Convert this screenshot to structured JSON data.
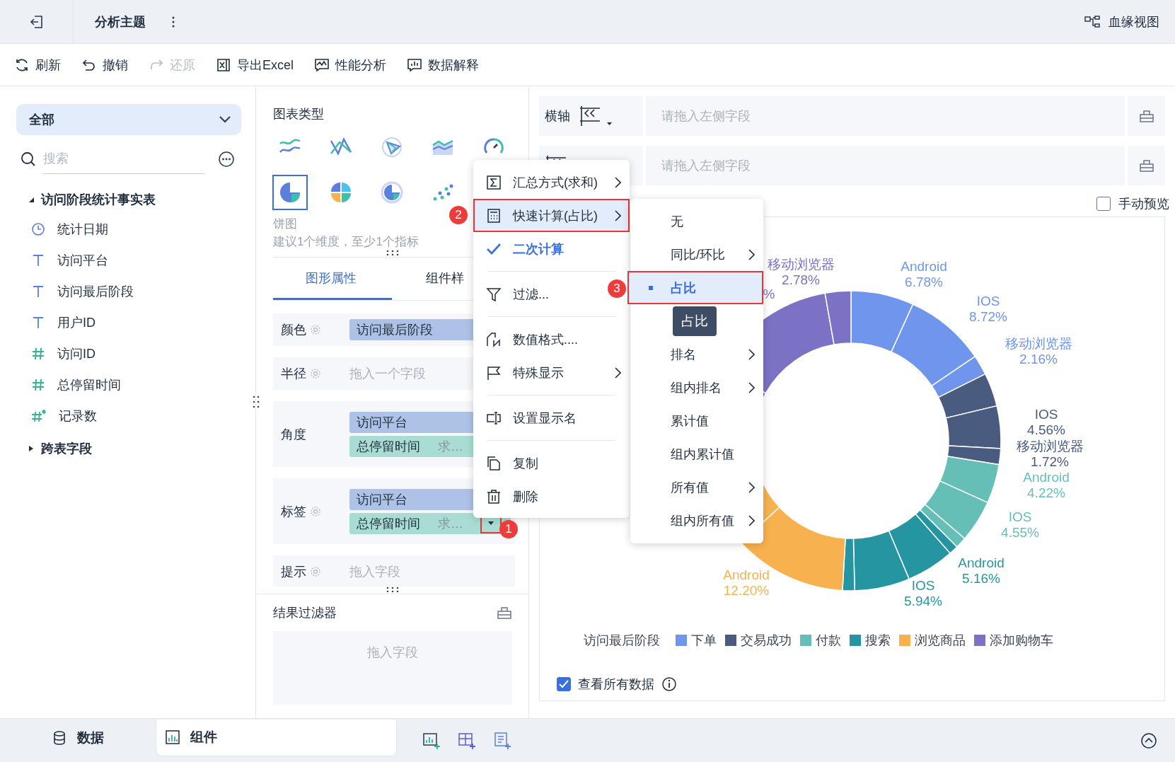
{
  "topbar": {
    "title": "分析主题",
    "lineage": "血缘视图"
  },
  "toolbar": [
    {
      "label": "刷新",
      "disabled": false
    },
    {
      "label": "撤销",
      "disabled": false
    },
    {
      "label": "还原",
      "disabled": true
    },
    {
      "label": "导出Excel",
      "disabled": false
    },
    {
      "label": "性能分析",
      "disabled": false
    },
    {
      "label": "数据解释",
      "disabled": false
    }
  ],
  "left": {
    "scope": "全部",
    "search_placeholder": "搜索",
    "tree": [
      {
        "name": "访问阶段统计事实表",
        "expanded": true,
        "children": [
          {
            "name": "统计日期",
            "kind": "date"
          },
          {
            "name": "访问平台",
            "kind": "text"
          },
          {
            "name": "访问最后阶段",
            "kind": "text"
          },
          {
            "name": "用户ID",
            "kind": "text"
          },
          {
            "name": "访问ID",
            "kind": "number"
          },
          {
            "name": "总停留时间",
            "kind": "number"
          },
          {
            "name": "记录数",
            "kind": "count"
          }
        ]
      },
      {
        "name": "跨表字段",
        "expanded": false
      }
    ]
  },
  "middle": {
    "title": "图表类型",
    "chart_types": [
      {
        "selected": false
      },
      {
        "selected": false
      },
      {
        "selected": false
      },
      {
        "selected": false
      },
      {
        "selected": false
      },
      {
        "selected": true
      },
      {
        "selected": false
      },
      {
        "selected": false
      },
      {
        "selected": false
      }
    ],
    "chart_name": "饼图",
    "hint": "建议1个维度，至少1个指标",
    "tabs": [
      {
        "label": "图形属性",
        "selected": true
      },
      {
        "label": "组件样",
        "selected": false
      }
    ],
    "properties": [
      {
        "label": "颜色",
        "gear": true,
        "fields": [
          {
            "name": "访问最后阶段",
            "kind": "dimension"
          }
        ]
      },
      {
        "label": "半径",
        "gear": true,
        "placeholder": "拖入一个字段"
      },
      {
        "label": "角度",
        "gear": false,
        "fields": [
          {
            "name": "访问平台",
            "kind": "dimension"
          },
          {
            "name": "总停留时间",
            "kind": "measure",
            "agg": "求…"
          }
        ]
      },
      {
        "label": "标签",
        "gear": true,
        "fields": [
          {
            "name": "访问平台",
            "kind": "dimension"
          },
          {
            "name": "总停留时间",
            "kind": "measure",
            "agg": "求…",
            "dropdown": true,
            "annotation": "1"
          }
        ]
      },
      {
        "label": "提示",
        "gear": true,
        "placeholder": "拖入字段"
      }
    ],
    "result_filter": {
      "title": "结果过滤器",
      "placeholder": "拖入字段"
    }
  },
  "right": {
    "axes": [
      {
        "label": "横轴",
        "placeholder": "请拖入左侧字段"
      },
      {
        "placeholder": "请拖入左侧字段"
      }
    ],
    "manual_preview": {
      "label": "手动预览",
      "checked": false
    },
    "chart": {
      "legend_title": "访问最后阶段",
      "series": [
        {
          "name": "下单",
          "color": "#6f95ec",
          "labels": [
            {
              "lines": [
                "Android",
                "6.78%"
              ]
            },
            {
              "lines": [
                "IOS",
                "8.72%"
              ]
            },
            {
              "lines": [
                "移动浏览器",
                "2.16%"
              ]
            }
          ]
        },
        {
          "name": "交易成功",
          "color": "#4a5b80",
          "labels": [
            {
              "lines": [
                "IOS",
                "4.56%"
              ]
            },
            {
              "lines": [
                "移动浏览器",
                "1.72%"
              ]
            }
          ]
        },
        {
          "name": "付款",
          "color": "#66bfb6",
          "labels": [
            {
              "lines": [
                "Android",
                "4.22%"
              ]
            },
            {
              "lines": [
                "IOS",
                "4.55%"
              ]
            }
          ]
        },
        {
          "name": "搜索",
          "color": "#2596a1",
          "labels": [
            {
              "lines": [
                "Android",
                "5.16%"
              ]
            },
            {
              "lines": [
                "IOS",
                "5.94%"
              ]
            }
          ]
        },
        {
          "name": "浏览商品",
          "color": "#f7b24f",
          "labels": [
            {
              "lines": [
                "Android",
                "12.20%"
              ]
            }
          ]
        },
        {
          "name": "添加购物车",
          "color": "#7b72c6",
          "labels": [
            {
              "lines": [
                "移动浏览器",
                "2.78%"
              ]
            },
            {
              "lines": [
                "%"
              ]
            }
          ]
        }
      ]
    },
    "show_all": {
      "label": "查看所有数据",
      "checked": true
    }
  },
  "bottom": {
    "tabs": [
      {
        "label": "数据",
        "selected": false
      },
      {
        "label": "组件",
        "selected": true
      }
    ]
  },
  "menu": {
    "items": [
      {
        "label": "汇总方式(求和)",
        "submenu": true,
        "highlighted": false,
        "checked": false,
        "divider_after": false
      },
      {
        "label": "快速计算(占比)",
        "submenu": true,
        "highlighted": true,
        "checked": false,
        "divider_after": false,
        "annotation": "2"
      },
      {
        "label": "二次计算",
        "submenu": false,
        "highlighted": false,
        "checked": true,
        "divider_after": true
      },
      {
        "label": "过滤...",
        "submenu": false,
        "highlighted": false,
        "checked": false,
        "divider_after": true
      },
      {
        "label": "数值格式....",
        "submenu": false,
        "highlighted": false,
        "checked": false,
        "divider_after": false
      },
      {
        "label": "特殊显示",
        "submenu": true,
        "highlighted": false,
        "checked": false,
        "divider_after": true
      },
      {
        "label": "设置显示名",
        "submenu": false,
        "highlighted": false,
        "checked": false,
        "divider_after": true
      },
      {
        "label": "复制",
        "submenu": false,
        "highlighted": false,
        "checked": false,
        "divider_after": false
      },
      {
        "label": "删除",
        "submenu": false,
        "highlighted": false,
        "checked": false,
        "divider_after": false
      }
    ]
  },
  "submenu": {
    "items": [
      {
        "kind": "item",
        "label": "无",
        "submenu": false,
        "selected": false
      },
      {
        "kind": "item",
        "label": "同比/环比",
        "submenu": true,
        "selected": false
      },
      {
        "kind": "item",
        "label": "占比",
        "submenu": false,
        "selected": true,
        "annotation": "3"
      },
      {
        "kind": "tooltip",
        "label": "占比"
      },
      {
        "kind": "item",
        "label": "排名",
        "submenu": true,
        "selected": false
      },
      {
        "kind": "item",
        "label": "组内排名",
        "submenu": true,
        "selected": false
      },
      {
        "kind": "item",
        "label": "累计值",
        "submenu": false,
        "selected": false
      },
      {
        "kind": "item",
        "label": "组内累计值",
        "submenu": false,
        "selected": false
      },
      {
        "kind": "item",
        "label": "所有值",
        "submenu": true,
        "selected": false
      },
      {
        "kind": "item",
        "label": "组内所有值",
        "submenu": true,
        "selected": false
      }
    ]
  }
}
